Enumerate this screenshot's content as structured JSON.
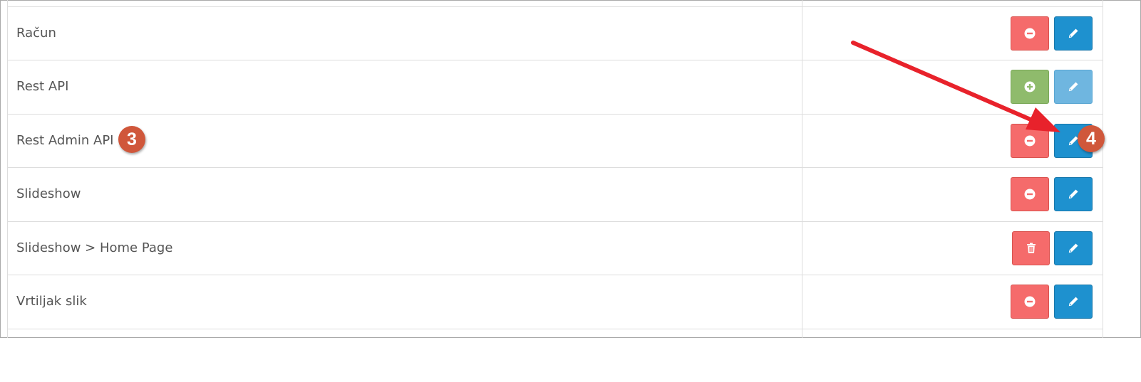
{
  "rows": [
    {
      "name": "Račun",
      "action": "remove"
    },
    {
      "name": "Rest API",
      "action": "install"
    },
    {
      "name": "Rest Admin API",
      "action": "remove"
    },
    {
      "name": "Slideshow",
      "action": "remove"
    },
    {
      "name": "Slideshow > Home Page",
      "action": "delete"
    },
    {
      "name": "Vrtiljak slik",
      "action": "remove"
    }
  ],
  "annotations": {
    "badge_3": "3",
    "badge_4": "4"
  },
  "colors": {
    "remove": "#f56b6b",
    "install": "#8fbb6c",
    "edit": "#1e91cf",
    "edit_disabled": "#6fb6e0",
    "badge": "#d0573b",
    "arrow": "#e8222b"
  },
  "icons": {
    "remove": "minus-circle-icon",
    "install": "plus-circle-icon",
    "delete": "trash-icon",
    "edit": "pencil-icon"
  }
}
